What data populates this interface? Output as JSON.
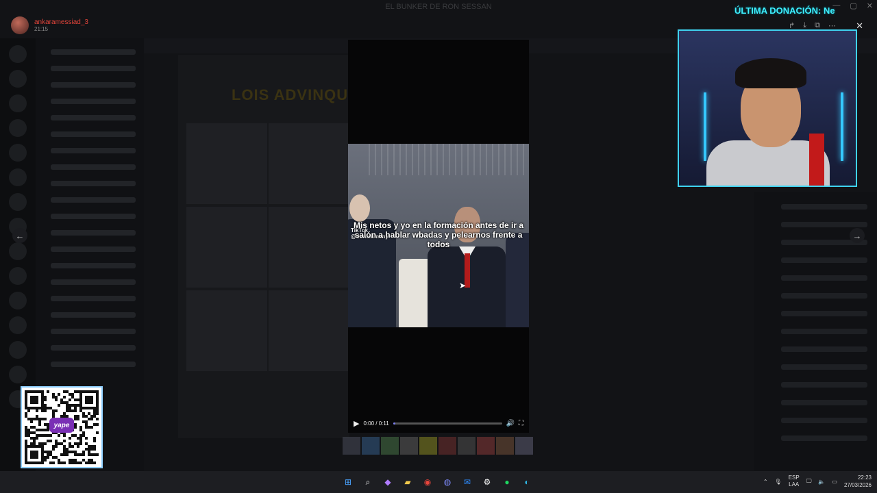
{
  "window": {
    "title": "EL BUNKER DE RON SESSAN"
  },
  "overlay": {
    "user": {
      "name": "ankaramessiad_3",
      "time": "21:15"
    },
    "toolbar_icons": [
      "share-icon",
      "download-icon",
      "open-external-icon",
      "more-icon"
    ],
    "close_label": "✕",
    "prev_label": "←",
    "next_label": "→"
  },
  "video": {
    "caption": "Mis netos y yo en la formación antes de ir a salón a hablar wbadas y pelearnos frente a todos",
    "watermark_brand": "TikTok",
    "watermark_handle": "@donaldmany",
    "time": "0:00 / 0:11",
    "progress": 0.0
  },
  "thumbnails_count": 10,
  "stream": {
    "donation_text": "ÚLTIMA DONACIÓN: Ne",
    "qr_brand": "yape",
    "accent": "#3fd3f0"
  },
  "background": {
    "faded_title": "LOIS ADVINQU"
  },
  "taskbar": {
    "icons": [
      "windows-start-icon",
      "search-icon",
      "copilot-icon",
      "file-explorer-icon",
      "chrome-icon",
      "discord-icon",
      "mail-icon",
      "steam-icon",
      "spotify-icon",
      "edge-icon"
    ],
    "lang_top": "ESP",
    "lang_bottom": "LAA",
    "time": "22:23",
    "date": "27/03/2026"
  }
}
